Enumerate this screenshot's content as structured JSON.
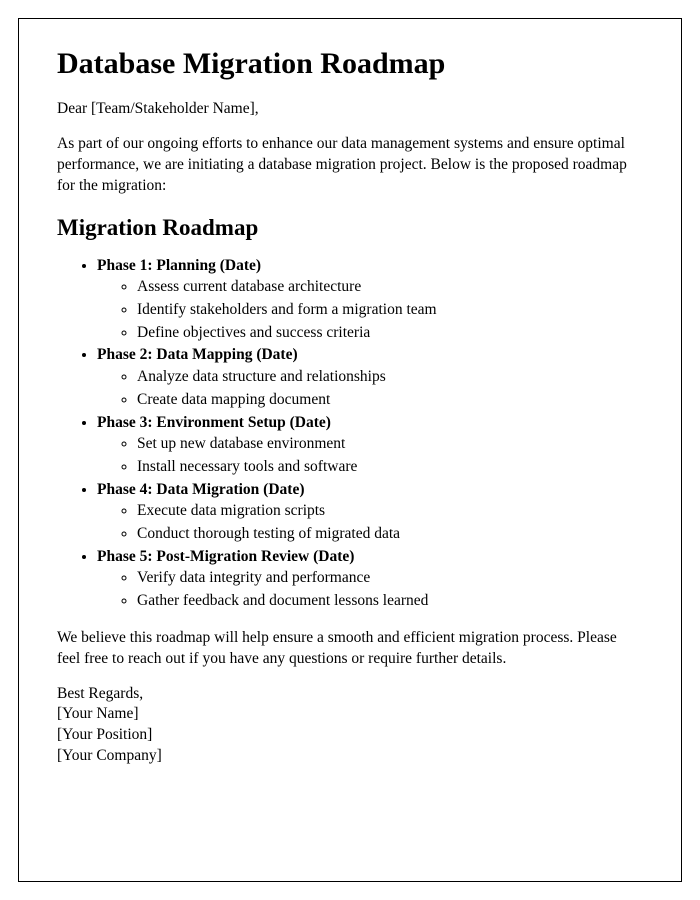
{
  "title": "Database Migration Roadmap",
  "salutation": "Dear [Team/Stakeholder Name],",
  "intro": "As part of our ongoing efforts to enhance our data management systems and ensure optimal performance, we are initiating a database migration project. Below is the proposed roadmap for the migration:",
  "section_heading": "Migration Roadmap",
  "phases": [
    {
      "title": "Phase 1: Planning (Date)",
      "tasks": [
        "Assess current database architecture",
        "Identify stakeholders and form a migration team",
        "Define objectives and success criteria"
      ]
    },
    {
      "title": "Phase 2: Data Mapping (Date)",
      "tasks": [
        "Analyze data structure and relationships",
        "Create data mapping document"
      ]
    },
    {
      "title": "Phase 3: Environment Setup (Date)",
      "tasks": [
        "Set up new database environment",
        "Install necessary tools and software"
      ]
    },
    {
      "title": "Phase 4: Data Migration (Date)",
      "tasks": [
        "Execute data migration scripts",
        "Conduct thorough testing of migrated data"
      ]
    },
    {
      "title": "Phase 5: Post-Migration Review (Date)",
      "tasks": [
        "Verify data integrity and performance",
        "Gather feedback and document lessons learned"
      ]
    }
  ],
  "closing": "We believe this roadmap will help ensure a smooth and efficient migration process. Please feel free to reach out if you have any questions or require further details.",
  "signature": {
    "regards": "Best Regards,",
    "name": "[Your Name]",
    "position": "[Your Position]",
    "company": "[Your Company]"
  }
}
